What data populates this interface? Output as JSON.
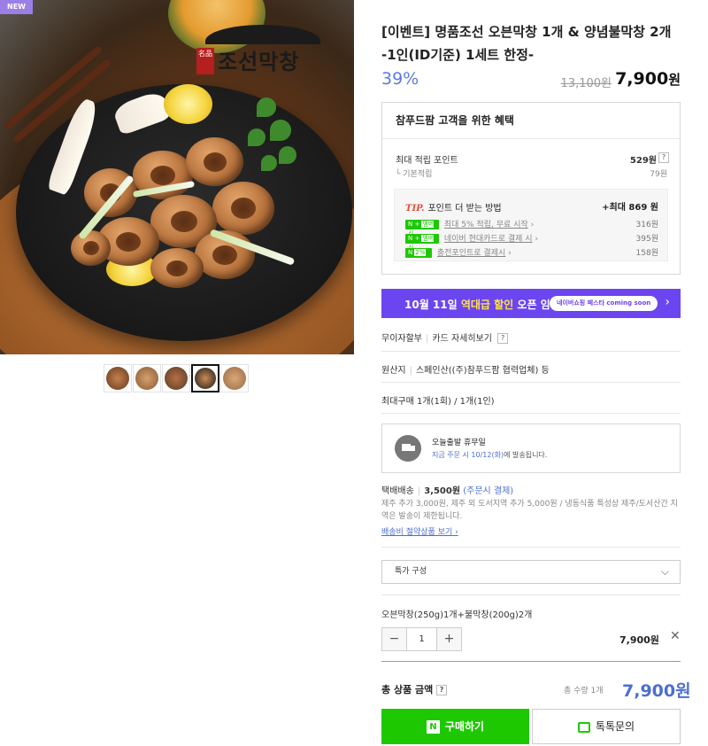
{
  "badge": "NEW",
  "hero": {
    "logo_seal": "名品",
    "logo_text": "조선막창"
  },
  "product": {
    "title": "[이벤트] 명품조선 오븐막창 1개 & 양념불막창 2개 -1인(ID기준) 1세트 한정-",
    "discount": "39%",
    "original_price": "13,100원",
    "sale_price": "7,900",
    "sale_price_unit": "원"
  },
  "benefit": {
    "header": "참푸드팜 고객을 위한 혜택",
    "max_points_label": "최대 적립 포인트",
    "max_points_value": "529원",
    "base_label": "기본적립",
    "base_value": "79원",
    "tip_label": "TIP.",
    "tip_title": "포인트 더 받는 방법",
    "tip_max": "+최대 869 원",
    "tips": [
      {
        "badge": "N +",
        "badge_sub": "멤버십",
        "label": "최대 5% 적립, 무료 시작",
        "value": "316원"
      },
      {
        "badge": "N +",
        "badge_sub": "멤버십",
        "label": "네이버 현대카드로 결제 시",
        "value": "395원"
      },
      {
        "badge": "N",
        "badge_sub": "2%",
        "label": "충전포인트로 결제시",
        "value": "158원"
      }
    ]
  },
  "banner": {
    "text_pre": "10월 11일 ",
    "text_hl": "역대급 할인",
    "text_post": " 오픈 임박!",
    "sub": "네이버쇼핑 페스타 coming soon",
    "chevron": "›"
  },
  "payment": {
    "installment": "무이자할부",
    "card_detail": "카드 자세히보기",
    "q": "?"
  },
  "origin": {
    "label": "원산지",
    "value": "스페인산((주)참푸드팜 협력업체) 등"
  },
  "max_purchase": "최대구매 1개(1회) / 1개(1인)",
  "delivery": {
    "title": "오늘출발 휴무일",
    "sub_pre": "지금 주문 시 10/12(화)",
    "sub_post": "에 발송됩니다."
  },
  "shipping": {
    "label": "택배배송",
    "fee": "3,500원",
    "method": "(주문시 결제)",
    "note": "제주 추가 3,000원, 제주 외 도서지역 추가 5,000원 / 냉동식품 특성상 제주/도서산간 지역은 발송이 제한됩니다.",
    "link": "배송비 절약상품 보기"
  },
  "select": {
    "value": "특가 구성",
    "chevron": "⌵"
  },
  "option": {
    "name": "오븐막창(250g)1개+불막창(200g)2개",
    "qty": "1",
    "minus": "−",
    "plus": "+",
    "price": "7,900원",
    "remove": "✕"
  },
  "total": {
    "label": "총 상품 금액",
    "qty": "총 수량 1개",
    "price": "7,900원"
  },
  "actions": {
    "buy": "구매하기",
    "buy_icon": "N",
    "talk": "톡톡문의"
  }
}
